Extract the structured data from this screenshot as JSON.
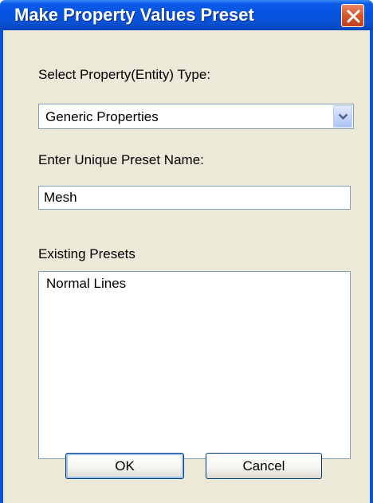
{
  "window": {
    "title": "Make Property Values Preset"
  },
  "property_type": {
    "label": "Select Property(Entity) Type:",
    "selected": "Generic Properties"
  },
  "preset_name": {
    "label": "Enter Unique Preset Name:",
    "value": "Mesh"
  },
  "existing_presets": {
    "label": "Existing Presets",
    "items": [
      "Normal Lines"
    ]
  },
  "buttons": {
    "ok_label": "OK",
    "cancel_label": "Cancel"
  },
  "icons": {
    "close": "close-icon",
    "dropdown": "chevron-down-icon"
  },
  "colors": {
    "titlebar": "#0553e0",
    "dialog_background": "#ece9d8",
    "close_button": "#d8562b",
    "field_border": "#7f9db9"
  }
}
